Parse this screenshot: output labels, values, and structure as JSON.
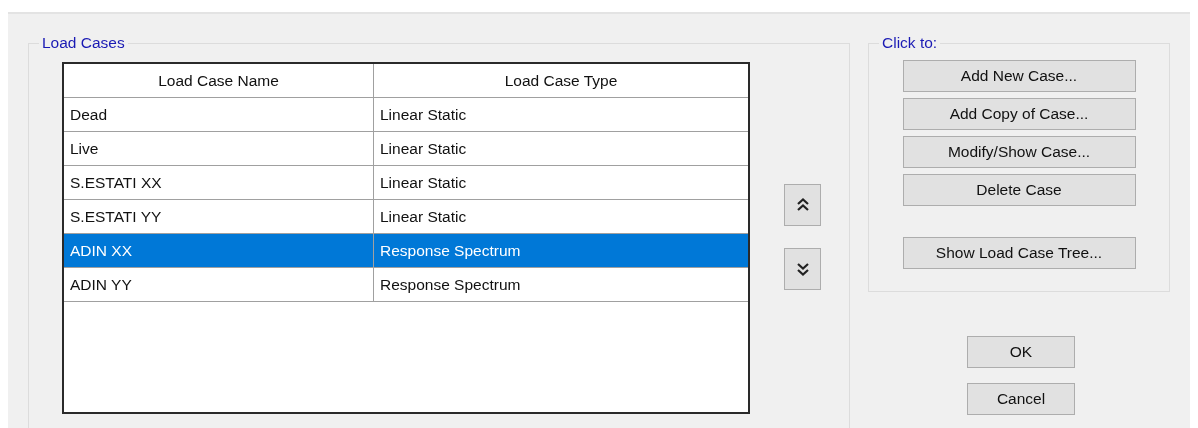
{
  "load_cases": {
    "legend": "Load Cases",
    "columns": [
      "Load Case Name",
      "Load Case Type"
    ],
    "rows": [
      {
        "name": "Dead",
        "type": "Linear Static",
        "selected": false
      },
      {
        "name": "Live",
        "type": "Linear Static",
        "selected": false
      },
      {
        "name": "S.ESTATI XX",
        "type": "Linear Static",
        "selected": false
      },
      {
        "name": "S.ESTATI YY",
        "type": "Linear Static",
        "selected": false
      },
      {
        "name": "ADIN XX",
        "type": "Response Spectrum",
        "selected": true
      },
      {
        "name": "ADIN YY",
        "type": "Response Spectrum",
        "selected": false
      }
    ]
  },
  "click_to": {
    "legend": "Click to:",
    "buttons": [
      {
        "label": "Add New Case..."
      },
      {
        "label": "Add Copy of Case..."
      },
      {
        "label": "Modify/Show Case..."
      },
      {
        "label": "Delete Case"
      }
    ],
    "tree_button": "Show Load Case Tree..."
  },
  "dialog_buttons": [
    "OK",
    "Cancel"
  ]
}
